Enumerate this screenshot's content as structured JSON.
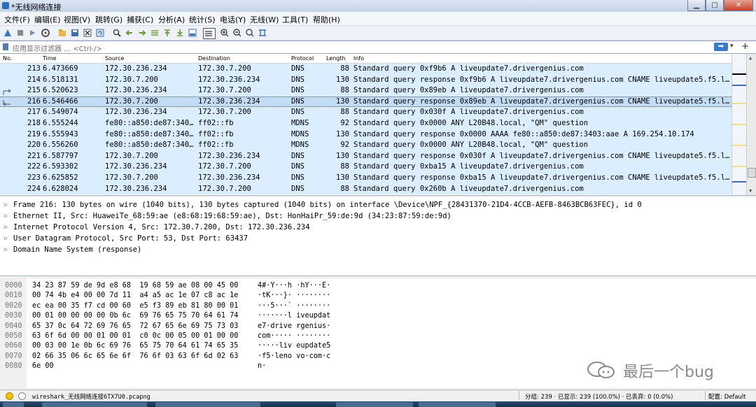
{
  "window": {
    "title": "*无线网络连接"
  },
  "menu": [
    "文件(F)",
    "编辑(E)",
    "视图(V)",
    "跳转(G)",
    "捕获(C)",
    "分析(A)",
    "统计(S)",
    "电话(Y)",
    "无线(W)",
    "工具(T)",
    "帮助(H)"
  ],
  "filter": {
    "placeholder": "应用显示过滤器 … <Ctrl-/>"
  },
  "columns": [
    "No.",
    "Time",
    "Source",
    "Destination",
    "Protocol",
    "Length",
    "Info"
  ],
  "packets": [
    {
      "no": "213",
      "time": "6.473669",
      "src": "172.30.236.234",
      "dst": "172.30.7.200",
      "proto": "DNS",
      "len": "88",
      "info": "Standard query 0xf9b6 A liveupdate7.drivergenius.com"
    },
    {
      "no": "214",
      "time": "6.518131",
      "src": "172.30.7.200",
      "dst": "172.30.236.234",
      "proto": "DNS",
      "len": "130",
      "info": "Standard query response 0xf9b6 A liveupdate7.drivergenius.com CNAME liveupdate5.f5.l…"
    },
    {
      "no": "215",
      "time": "6.520623",
      "src": "172.30.236.234",
      "dst": "172.30.7.200",
      "proto": "DNS",
      "len": "88",
      "info": "Standard query 0x89eb A liveupdate7.drivergenius.com"
    },
    {
      "no": "216",
      "time": "6.546466",
      "src": "172.30.7.200",
      "dst": "172.30.236.234",
      "proto": "DNS",
      "len": "130",
      "info": "Standard query response 0x89eb A liveupdate7.drivergenius.com CNAME liveupdate5.f5.l…"
    },
    {
      "no": "217",
      "time": "6.549074",
      "src": "172.30.236.234",
      "dst": "172.30.7.200",
      "proto": "DNS",
      "len": "88",
      "info": "Standard query 0x030f A liveupdate7.drivergenius.com"
    },
    {
      "no": "218",
      "time": "6.555244",
      "src": "fe80::a850:de87:340…",
      "dst": "ff02::fb",
      "proto": "MDNS",
      "len": "92",
      "info": "Standard query 0x0000 ANY L20B48.local, \"QM\" question"
    },
    {
      "no": "219",
      "time": "6.555943",
      "src": "fe80::a850:de87:340…",
      "dst": "ff02::fb",
      "proto": "MDNS",
      "len": "130",
      "info": "Standard query response 0x0000 AAAA fe80::a850:de87:3403:aae A 169.254.10.174"
    },
    {
      "no": "220",
      "time": "6.556260",
      "src": "fe80::a850:de87:340…",
      "dst": "ff02::fb",
      "proto": "MDNS",
      "len": "92",
      "info": "Standard query 0x0000 ANY L20B48.local, \"QM\" question"
    },
    {
      "no": "221",
      "time": "6.587797",
      "src": "172.30.7.200",
      "dst": "172.30.236.234",
      "proto": "DNS",
      "len": "130",
      "info": "Standard query response 0x030f A liveupdate7.drivergenius.com CNAME liveupdate5.f5.l…"
    },
    {
      "no": "222",
      "time": "6.593302",
      "src": "172.30.236.234",
      "dst": "172.30.7.200",
      "proto": "DNS",
      "len": "88",
      "info": "Standard query 0xba15 A liveupdate7.drivergenius.com"
    },
    {
      "no": "223",
      "time": "6.625852",
      "src": "172.30.7.200",
      "dst": "172.30.236.234",
      "proto": "DNS",
      "len": "130",
      "info": "Standard query response 0xba15 A liveupdate7.drivergenius.com CNAME liveupdate5.f5.l…"
    },
    {
      "no": "224",
      "time": "6.628024",
      "src": "172.30.236.234",
      "dst": "172.30.7.200",
      "proto": "DNS",
      "len": "88",
      "info": "Standard query 0x260b A liveupdate7.drivergenius.com"
    }
  ],
  "selected_packet": "216",
  "details": [
    "Frame 216: 130 bytes on wire (1040 bits), 130 bytes captured (1040 bits) on interface \\Device\\NPF_{28431370-21D4-4CCB-AEFB-8463BCB63FEC}, id 0",
    "Ethernet II, Src: HuaweiTe_68:59:ae (e8:68:19:68:59:ae), Dst: HonHaiPr_59:de:9d (34:23:87:59:de:9d)",
    "Internet Protocol Version 4, Src: 172.30.7.200, Dst: 172.30.236.234",
    "User Datagram Protocol, Src Port: 53, Dst Port: 63437",
    "Domain Name System (response)"
  ],
  "bytes": [
    {
      "off": "0000",
      "hex": "34 23 87 59 de 9d e8 68  19 68 59 ae 08 00 45 00",
      "ascii": "4#·Y···h ·hY···E·"
    },
    {
      "off": "0010",
      "hex": "00 74 4b e4 00 00 7d 11  a4 a5 ac 1e 07 c8 ac 1e",
      "ascii": "·tK···}· ········"
    },
    {
      "off": "0020",
      "hex": "ec ea 00 35 f7 cd 00 60  e5 f3 89 eb 81 80 00 01",
      "ascii": "···5···` ········"
    },
    {
      "off": "0030",
      "hex": "00 01 00 00 00 00 0b 6c  69 76 65 75 70 64 61 74",
      "ascii": "·······l iveupdat"
    },
    {
      "off": "0040",
      "hex": "65 37 0c 64 72 69 76 65  72 67 65 6e 69 75 73 03",
      "ascii": "e7·drive rgenius·"
    },
    {
      "off": "0050",
      "hex": "63 6f 6d 00 00 01 00 01  c0 0c 00 05 00 01 00 00",
      "ascii": "com····· ········"
    },
    {
      "off": "0060",
      "hex": "00 03 00 1e 0b 6c 69 76  65 75 70 64 61 74 65 35",
      "ascii": "·····liv eupdate5"
    },
    {
      "off": "0070",
      "hex": "02 66 35 06 6c 65 6e 6f  76 6f 03 63 6f 6d 02 63",
      "ascii": "·f5·leno vo·com·c"
    },
    {
      "off": "0080",
      "hex": "6e 00",
      "ascii": "n·"
    }
  ],
  "watermark": "最后一个bug",
  "status": {
    "file": "wireshark_无线网络连接6TX7U0.pcapng",
    "stats": "分组: 239 · 已显示: 239 (100.0%) · 已丢弃: 0 (0.0%)",
    "profile": "配置: Default"
  },
  "colors": {
    "row_bg": "#daeeff",
    "row_selected": "#c3dcf5"
  }
}
